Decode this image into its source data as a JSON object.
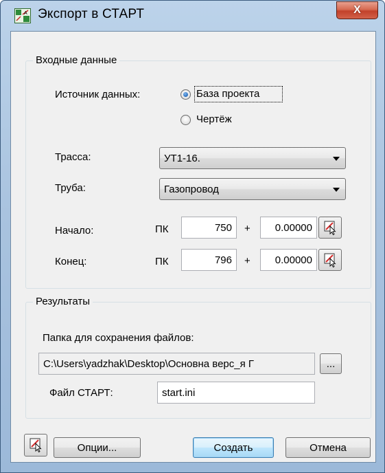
{
  "window": {
    "title": "Экспорт в СТАРТ",
    "close_label": "X"
  },
  "input_group": {
    "title": "Входные данные",
    "source_label": "Источник данных:",
    "source_options": [
      {
        "label": "База проекта",
        "checked": true
      },
      {
        "label": "Чертёж",
        "checked": false
      }
    ],
    "route_label": "Трасса:",
    "route_value": "УТ1-16.",
    "pipe_label": "Труба:",
    "pipe_value": "Газопровод",
    "start_label": "Начало:",
    "end_label": "Конец:",
    "pk_label": "ПК",
    "plus_label": "+",
    "start_pk": "750",
    "start_offset": "0.00000",
    "end_pk": "796",
    "end_offset": "0.00000"
  },
  "results_group": {
    "title": "Результаты",
    "folder_label": "Папка для сохранения файлов:",
    "folder_path": "C:\\Users\\yadzhak\\Desktop\\Основна верс_я Г",
    "browse_label": "...",
    "file_label": "Файл СТАРТ:",
    "file_value": "start.ini"
  },
  "footer": {
    "options_label": "Опции...",
    "create_label": "Создать",
    "cancel_label": "Отмена"
  },
  "colors": {
    "accent_default_button": "#3c7fb1",
    "close_button": "#c2412a"
  }
}
